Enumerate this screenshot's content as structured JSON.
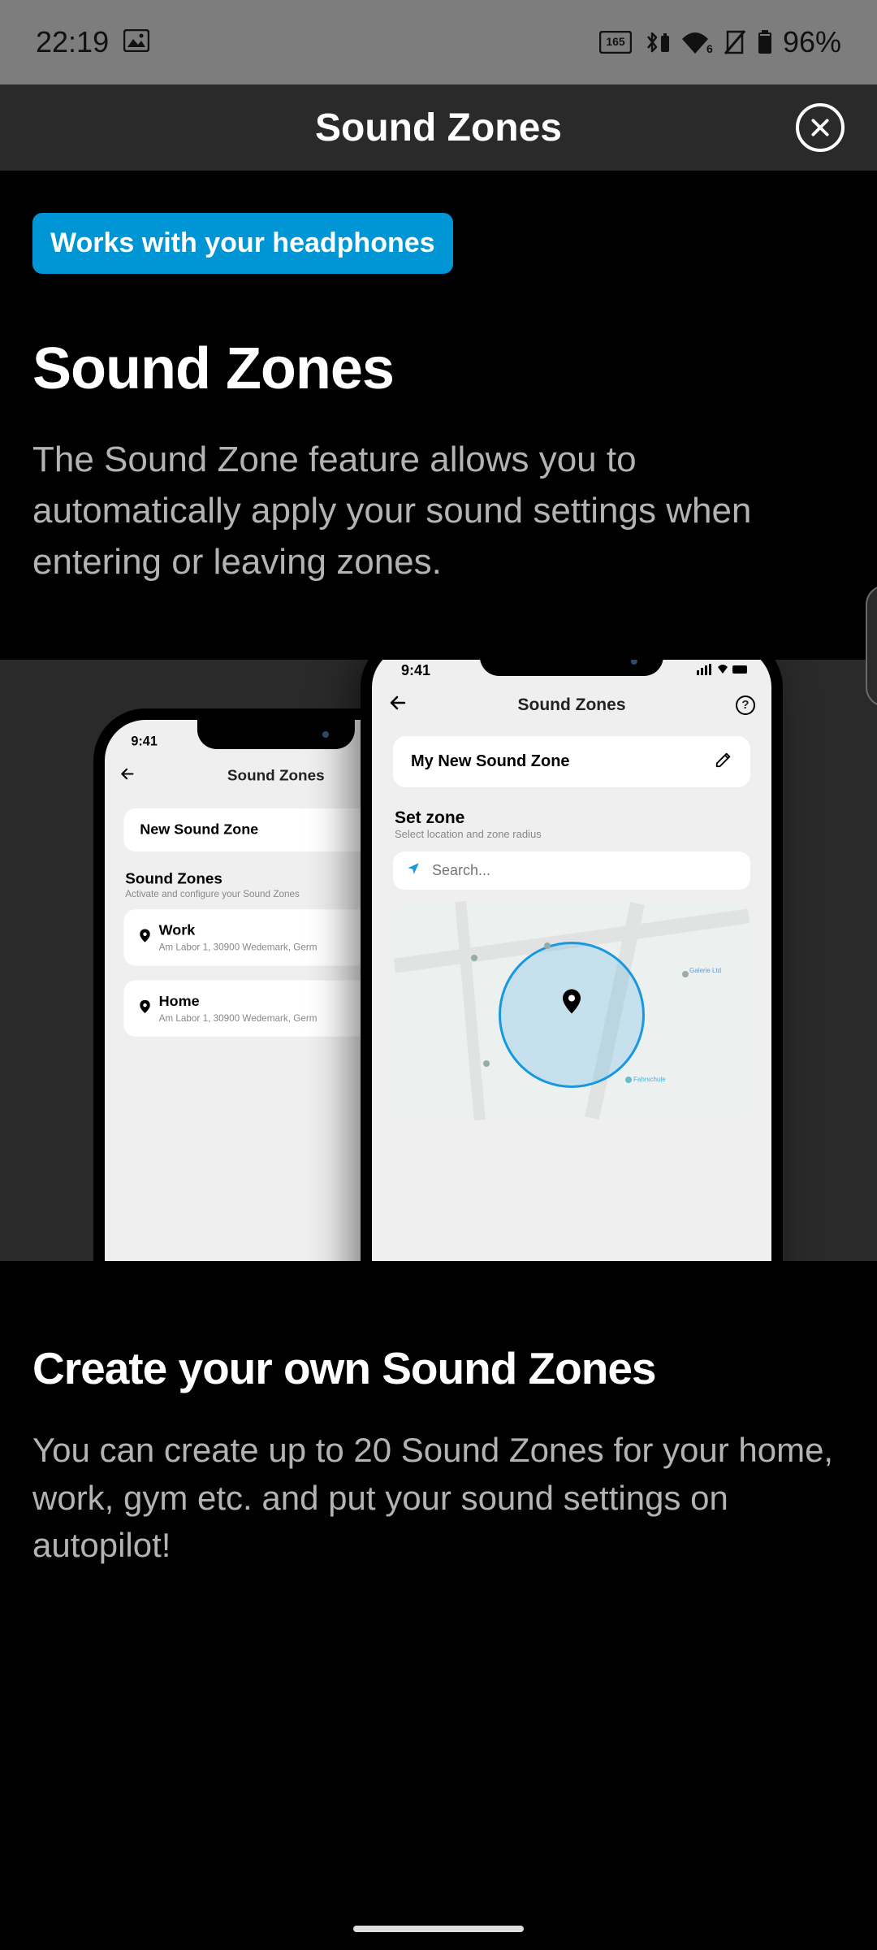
{
  "statusbar": {
    "time": "22:19",
    "battery_pct": "96%"
  },
  "header": {
    "title": "Sound Zones"
  },
  "intro": {
    "badge": "Works with your headphones",
    "title": "Sound Zones",
    "description": "The Sound Zone feature allows you to automatically apply your sound settings when entering or leaving zones."
  },
  "mockup": {
    "time": "9:41",
    "screen_title": "Sound Zones",
    "back_phone": {
      "new_zone": "New Sound Zone",
      "section": "Sound Zones",
      "section_sub": "Activate and configure your Sound Zones",
      "items": [
        {
          "name": "Work",
          "address": "Am Labor 1, 30900 Wedemark, Germ"
        },
        {
          "name": "Home",
          "address": "Am Labor 1, 30900 Wedemark, Germ"
        }
      ]
    },
    "front_phone": {
      "zone_name": "My New Sound Zone",
      "set_zone": "Set zone",
      "set_zone_sub": "Select location and zone radius",
      "search_placeholder": "Search..."
    }
  },
  "section2": {
    "title": "Create your own Sound Zones",
    "description": "You can create up to 20 Sound Zones for your home, work, gym etc. and put your sound settings on autopilot!"
  }
}
